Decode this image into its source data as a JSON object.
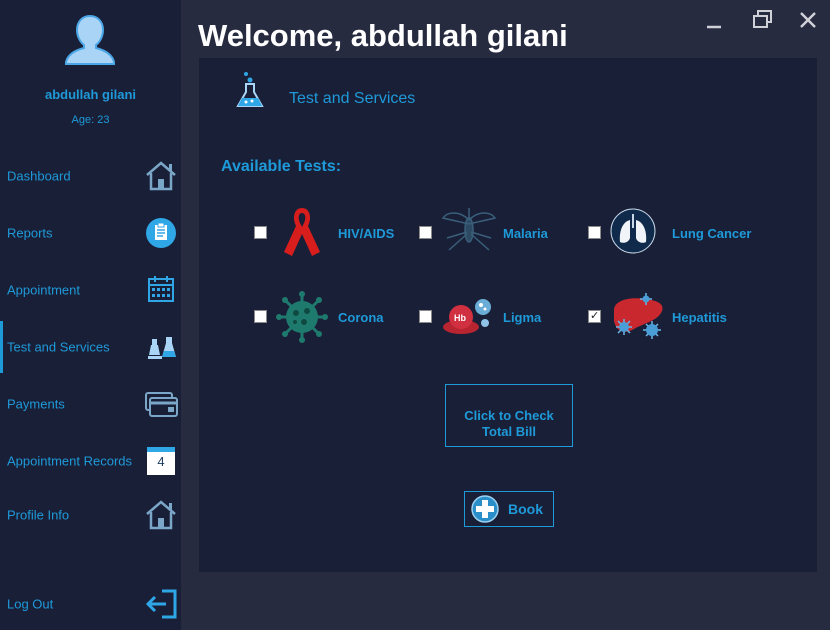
{
  "window": {
    "welcome": "Welcome, abdullah gilani",
    "minimize_icon": "minimize-icon",
    "restore_icon": "restore-icon",
    "close_icon": "close-icon"
  },
  "user": {
    "name": "abdullah gilani",
    "age": "Age: 23",
    "avatar_icon": "user-avatar-icon"
  },
  "sidebar": {
    "items": [
      {
        "label": "Dashboard",
        "icon": "home-icon"
      },
      {
        "label": "Reports",
        "icon": "clipboard-icon"
      },
      {
        "label": "Appointment",
        "icon": "calendar-icon"
      },
      {
        "label": "Test and Services",
        "icon": "lab-flask-icon",
        "active": true
      },
      {
        "label": "Payments",
        "icon": "credit-card-icon"
      },
      {
        "label": "Appointment Records",
        "icon": "calendar-page-icon",
        "badge": "4"
      },
      {
        "label": "Profile Info",
        "icon": "home-icon"
      }
    ],
    "logout": {
      "label": "Log Out",
      "icon": "logout-icon"
    }
  },
  "main": {
    "title": "Test and Services",
    "available_label": "Available Tests:",
    "tests": [
      {
        "name": "HIV/AIDS",
        "icon": "red-ribbon-icon",
        "checked": false
      },
      {
        "name": "Malaria",
        "icon": "mosquito-icon",
        "checked": false
      },
      {
        "name": "Lung Cancer",
        "icon": "lungs-icon",
        "checked": false
      },
      {
        "name": "Corona",
        "icon": "virus-icon",
        "checked": false
      },
      {
        "name": "Ligma",
        "icon": "blood-cell-icon",
        "checked": false,
        "hb_text": "Hb"
      },
      {
        "name": "Hepatitis",
        "icon": "liver-icon",
        "checked": true
      }
    ],
    "bill_button": {
      "line1": "Click to Check",
      "line2": "Total Bill"
    },
    "book_button": {
      "label": "Book",
      "icon": "plus-circle-icon"
    }
  },
  "colors": {
    "accent": "#1e9ad8",
    "sidebar_bg": "#1a1f38",
    "window_bg": "#272b40",
    "title_text": "#ffffff"
  }
}
